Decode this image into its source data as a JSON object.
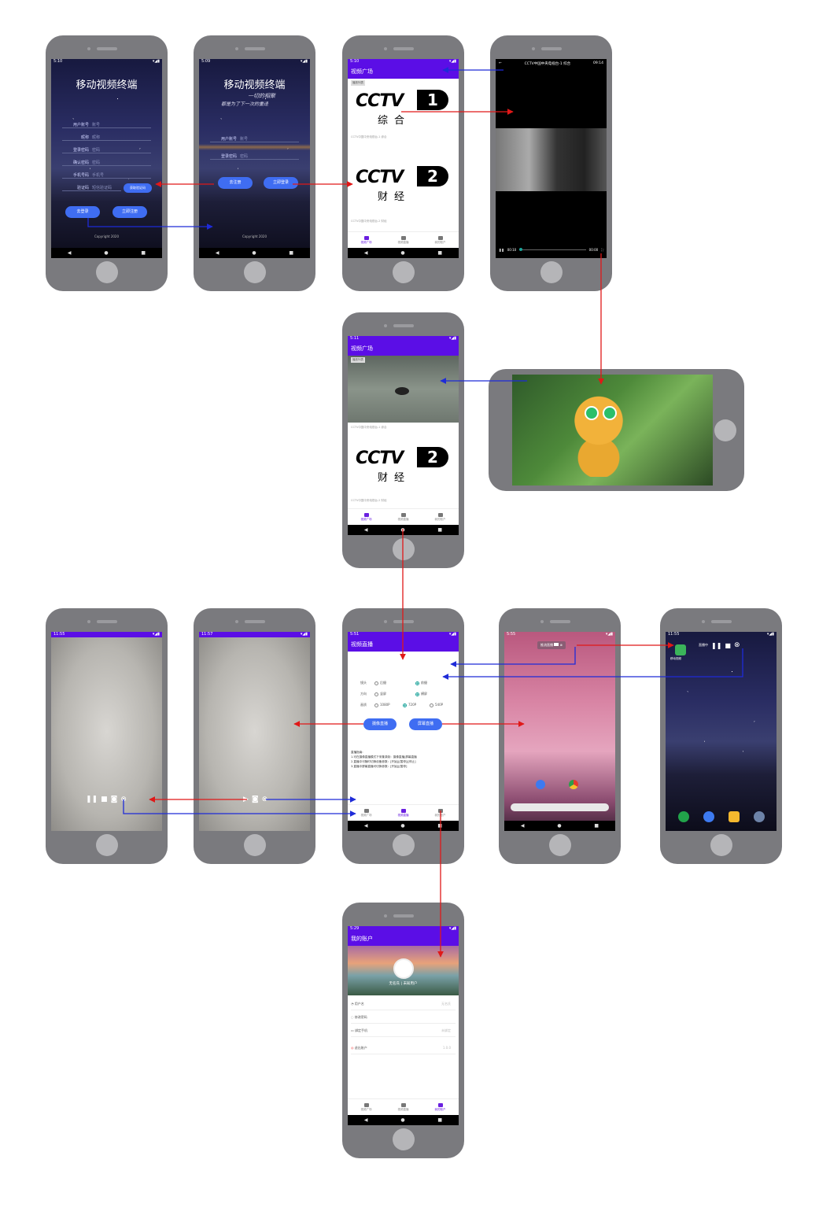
{
  "login": {
    "title": "移动视频终端",
    "fields": [
      {
        "label": "用户账号",
        "placeholder": "账号"
      },
      {
        "label": "昵称",
        "placeholder": "昵称"
      },
      {
        "label": "登录密码",
        "placeholder": "密码"
      },
      {
        "label": "确认密码",
        "placeholder": "密码"
      },
      {
        "label": "手机号码",
        "placeholder": "手机号"
      },
      {
        "label": "验证码",
        "placeholder": "短信验证码"
      }
    ],
    "get_code_btn": "获取验证码",
    "back_login_btn": "去登录",
    "register_btn": "立即注册",
    "footer": "Copyright 2020"
  },
  "login2": {
    "title": "移动视频终端",
    "slogan_line1": "一切的相聚",
    "slogan_line2": "都是为了下一次的重逢",
    "account_label": "用户账号",
    "account_placeholder": "账号",
    "password_label": "登录密码",
    "password_placeholder": "密码",
    "register_btn": "去注册",
    "login_btn": "立即登录",
    "footer": "Copyright 2020"
  },
  "square": {
    "app_title": "视频广场",
    "badge": "播放列表",
    "channels": [
      {
        "logo_num": "1",
        "logo_sub": "综合",
        "caption": "CCTV中国中央电视台-1 综合"
      },
      {
        "logo_num": "2",
        "logo_sub": "财经",
        "caption": "CCTV中国中央电视台-2 财经"
      }
    ],
    "tabs": [
      "视频广场",
      "视频直播",
      "我的账户"
    ]
  },
  "player": {
    "title": "CCTV中国中央电视台-1 综合",
    "clock": "09:14",
    "time_start": "00:10",
    "time_end": "00:00",
    "progress": 0.02
  },
  "live": {
    "app_title": "视频直播",
    "rows": [
      {
        "label": "镜头",
        "opt1": "后摄",
        "opt2": "前摄",
        "selected": 2
      },
      {
        "label": "方向",
        "opt1": "竖屏",
        "opt2": "横屏",
        "selected": 2
      },
      {
        "label": "画质",
        "opt1": "1080P",
        "opt2": "720P",
        "opt3": "540P",
        "selected": 2
      }
    ],
    "camera_btn": "摄像直播",
    "screen_btn": "屏幕直播",
    "notes_title": "直播指南:",
    "notes": [
      "1.可在摄像直播模式下采集录制：摄像直播|屏幕直播",
      "2.直播中可随时切换设备参数：[开始]|[暂停]|[停止]",
      "3.直播中屏幕直播可切换参数：[开始]|[暂停]"
    ]
  },
  "floating": {
    "label": "推流直播",
    "live_label": "直播中"
  },
  "account": {
    "app_title": "我的账户",
    "user_name": "无名氏",
    "user_sub": "未知用户",
    "rows": [
      {
        "label": "用户名",
        "value": "无名氏"
      },
      {
        "label": "修改密码",
        "value": ""
      },
      {
        "label": "绑定手机",
        "value": "未绑定"
      },
      {
        "label": "退出账户",
        "value": "1.0.0"
      }
    ]
  },
  "home": {
    "app_label": "移动视频"
  },
  "colors": {
    "accent": "#5b0ee6",
    "button": "#3f6df2",
    "arrow_red": "#e01818",
    "arrow_blue": "#1e2bd8"
  }
}
